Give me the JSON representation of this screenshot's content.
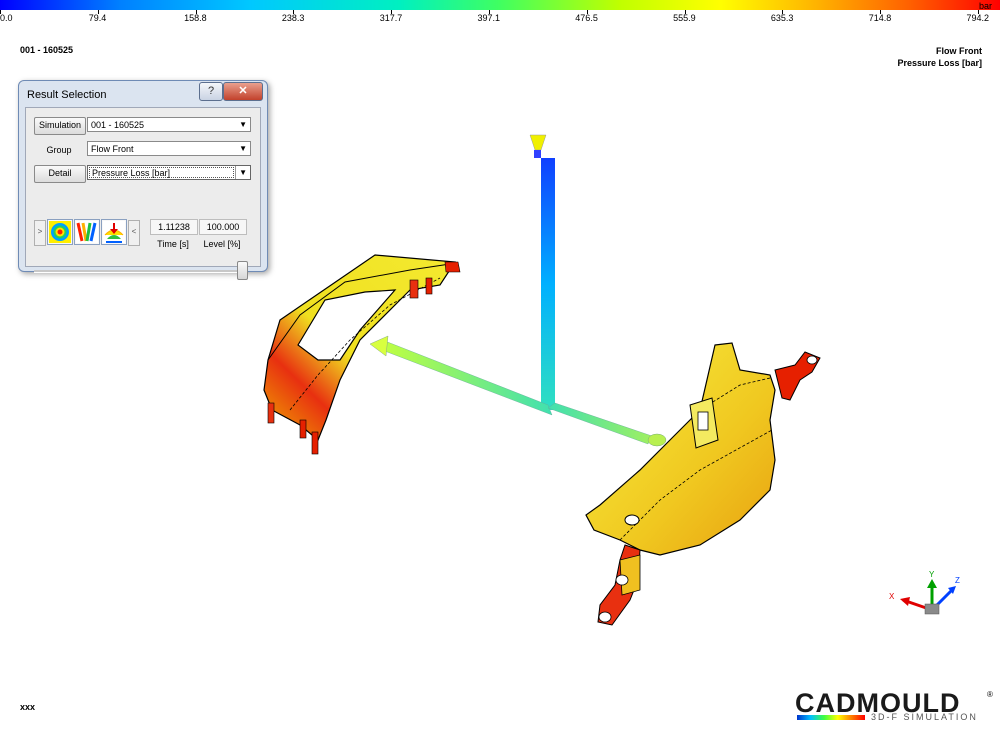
{
  "scale": {
    "unit": "bar",
    "min": 0.0,
    "max": 794.2,
    "ticks": [
      "0.0",
      "79.4",
      "158.8",
      "238.3",
      "317.7",
      "397.1",
      "476.5",
      "555.9",
      "635.3",
      "714.8",
      "794.2"
    ]
  },
  "header": {
    "simulation_id": "001 - 160525",
    "result_line1": "Flow Front",
    "result_line2": "Pressure Loss [bar]"
  },
  "dialog": {
    "title": "Result Selection",
    "help_label": "?",
    "close_label": "✕",
    "simulation_button": "Simulation",
    "simulation_value": "001  -  160525",
    "group_label": "Group",
    "group_value": "Flow Front",
    "detail_button": "Detail",
    "detail_value": "Pressure Loss [bar]",
    "prev_label": ">",
    "next_label": "<",
    "time_value": "1.11238",
    "time_caption": "Time [s]",
    "level_value": "100.000",
    "level_caption": "Level [%]",
    "slider_level": 1.0
  },
  "axes": {
    "x": "X",
    "y": "Y",
    "z": "Z"
  },
  "footer_text": "xxx",
  "logo": {
    "name": "CADMOULD",
    "reg": "®",
    "subtitle": "3D-F SIMULATION"
  }
}
